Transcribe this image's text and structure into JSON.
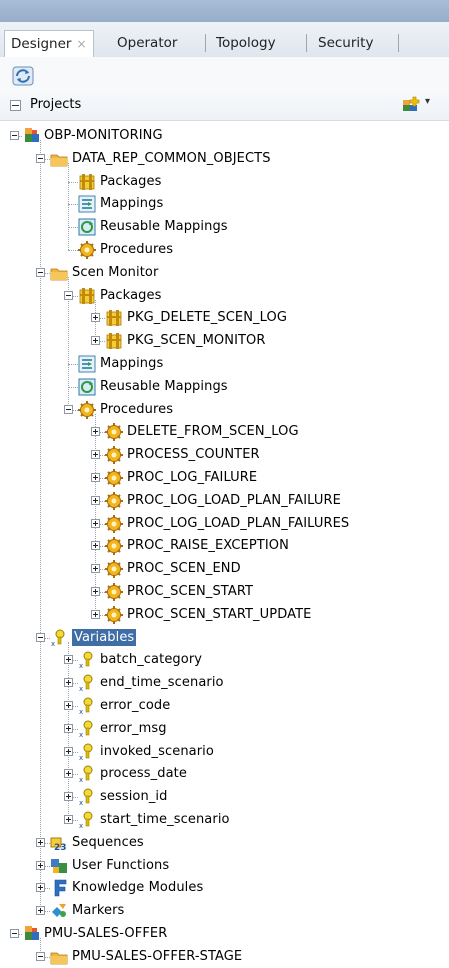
{
  "tabs": [
    {
      "label": "Designer",
      "close": "×"
    },
    {
      "label": "Operator"
    },
    {
      "label": "Topology"
    },
    {
      "label": "Security"
    }
  ],
  "toolbar": {
    "sync_icon": "refresh-sync-icon"
  },
  "projects_bar": {
    "label": "Projects",
    "add_icon": "new-project-icon",
    "menu_caret": "▾"
  },
  "tree": [
    {
      "label": "OBP-MONITORING",
      "icon": "project",
      "level": 0,
      "toggle": "minus"
    },
    {
      "label": "DATA_REP_COMMON_OBJECTS",
      "icon": "folder",
      "level": 1,
      "toggle": "minus"
    },
    {
      "label": "Packages",
      "icon": "package",
      "level": 2,
      "toggle": "none"
    },
    {
      "label": "Mappings",
      "icon": "mapping",
      "level": 2,
      "toggle": "none"
    },
    {
      "label": "Reusable Mappings",
      "icon": "reusable",
      "level": 2,
      "toggle": "none"
    },
    {
      "label": "Procedures",
      "icon": "procedure",
      "level": 2,
      "toggle": "none"
    },
    {
      "label": "Scen Monitor",
      "icon": "folder",
      "level": 1,
      "toggle": "minus"
    },
    {
      "label": "Packages",
      "icon": "package",
      "level": 2,
      "toggle": "minus"
    },
    {
      "label": "PKG_DELETE_SCEN_LOG",
      "icon": "package",
      "level": 3,
      "toggle": "plus"
    },
    {
      "label": "PKG_SCEN_MONITOR",
      "icon": "package",
      "level": 3,
      "toggle": "plus"
    },
    {
      "label": "Mappings",
      "icon": "mapping",
      "level": 2,
      "toggle": "none"
    },
    {
      "label": "Reusable Mappings",
      "icon": "reusable",
      "level": 2,
      "toggle": "none"
    },
    {
      "label": "Procedures",
      "icon": "procedure",
      "level": 2,
      "toggle": "minus"
    },
    {
      "label": "DELETE_FROM_SCEN_LOG",
      "icon": "procedure",
      "level": 3,
      "toggle": "plus"
    },
    {
      "label": "PROCESS_COUNTER",
      "icon": "procedure",
      "level": 3,
      "toggle": "plus"
    },
    {
      "label": "PROC_LOG_FAILURE",
      "icon": "procedure",
      "level": 3,
      "toggle": "plus"
    },
    {
      "label": "PROC_LOG_LOAD_PLAN_FAILURE",
      "icon": "procedure",
      "level": 3,
      "toggle": "plus"
    },
    {
      "label": "PROC_LOG_LOAD_PLAN_FAILURES",
      "icon": "procedure",
      "level": 3,
      "toggle": "plus"
    },
    {
      "label": "PROC_RAISE_EXCEPTION",
      "icon": "procedure",
      "level": 3,
      "toggle": "plus"
    },
    {
      "label": "PROC_SCEN_END",
      "icon": "procedure",
      "level": 3,
      "toggle": "plus"
    },
    {
      "label": "PROC_SCEN_START",
      "icon": "procedure",
      "level": 3,
      "toggle": "plus"
    },
    {
      "label": "PROC_SCEN_START_UPDATE",
      "icon": "procedure",
      "level": 3,
      "toggle": "plus"
    },
    {
      "label": "Variables",
      "icon": "variable",
      "level": 1,
      "toggle": "minus",
      "selected": true
    },
    {
      "label": "batch_category",
      "icon": "variable",
      "level": 2,
      "toggle": "plus"
    },
    {
      "label": "end_time_scenario",
      "icon": "variable",
      "level": 2,
      "toggle": "plus"
    },
    {
      "label": "error_code",
      "icon": "variable",
      "level": 2,
      "toggle": "plus"
    },
    {
      "label": "error_msg",
      "icon": "variable",
      "level": 2,
      "toggle": "plus"
    },
    {
      "label": "invoked_scenario",
      "icon": "variable",
      "level": 2,
      "toggle": "plus"
    },
    {
      "label": "process_date",
      "icon": "variable",
      "level": 2,
      "toggle": "plus"
    },
    {
      "label": "session_id",
      "icon": "variable",
      "level": 2,
      "toggle": "plus"
    },
    {
      "label": "start_time_scenario",
      "icon": "variable",
      "level": 2,
      "toggle": "plus"
    },
    {
      "label": "Sequences",
      "icon": "sequence",
      "level": 1,
      "toggle": "plus"
    },
    {
      "label": "User Functions",
      "icon": "function",
      "level": 1,
      "toggle": "plus"
    },
    {
      "label": "Knowledge Modules",
      "icon": "km",
      "level": 1,
      "toggle": "plus"
    },
    {
      "label": "Markers",
      "icon": "marker",
      "level": 1,
      "toggle": "plus"
    },
    {
      "label": "PMU-SALES-OFFER",
      "icon": "project",
      "level": 0,
      "toggle": "minus"
    },
    {
      "label": "PMU-SALES-OFFER-STAGE",
      "icon": "folder",
      "level": 1,
      "toggle": "minus"
    }
  ]
}
